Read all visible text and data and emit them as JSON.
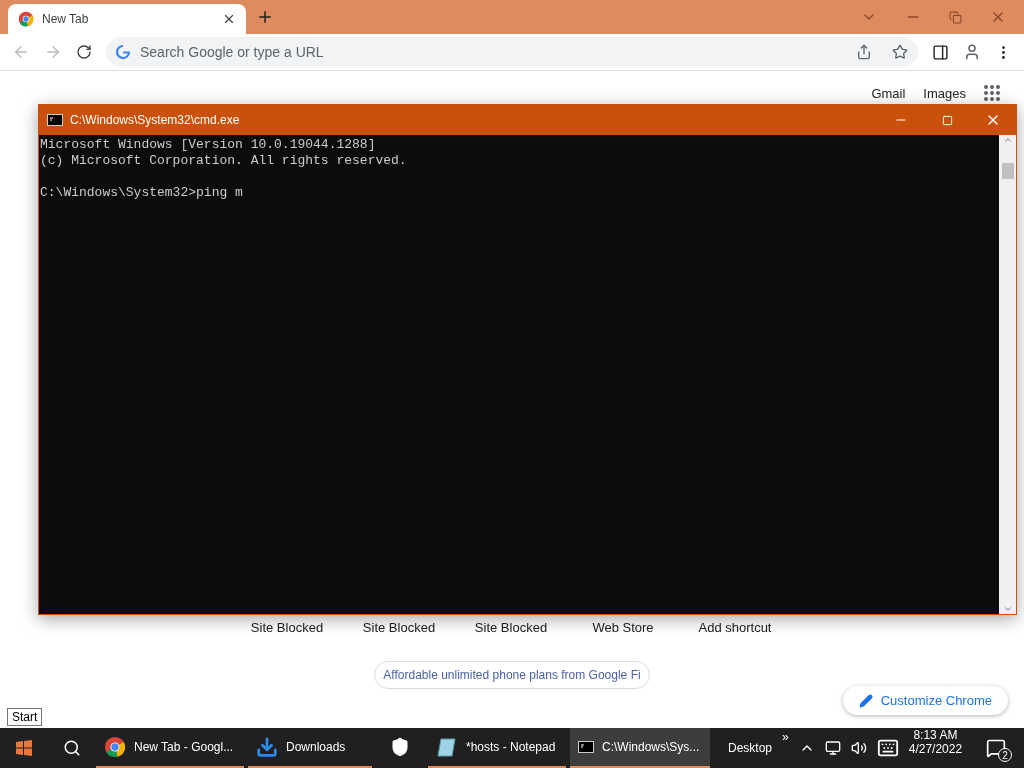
{
  "browser": {
    "tabs": [
      {
        "title": "New Tab",
        "selected": true
      }
    ],
    "omnibox": {
      "placeholder": "Search Google or type a URL"
    },
    "page": {
      "header_links": [
        "Gmail",
        "Images"
      ],
      "shortcuts": [
        "Site Blocked",
        "Site Blocked",
        "Site Blocked",
        "Web Store",
        "Add shortcut"
      ],
      "promo": "Affordable unlimited phone plans from Google Fi",
      "customize": "Customize Chrome"
    }
  },
  "console_window": {
    "title": "C:\\Windows\\System32\\cmd.exe",
    "paragraphs": [
      [
        "Microsoft Windows [Version 10.0.19044.1288]",
        "(c) Microsoft Corporation. All rights reserved."
      ],
      [
        "C:\\Windows\\System32>ping m"
      ]
    ]
  },
  "start_tooltip": "Start",
  "taskbar": {
    "items": [
      {
        "kind": "chrome",
        "label": "New Tab - Googl...",
        "running": true,
        "selected": false
      },
      {
        "kind": "download",
        "label": "Downloads",
        "running": true,
        "selected": false
      },
      {
        "kind": "shield",
        "running": false,
        "selected": false
      },
      {
        "kind": "notepad",
        "label": "*hosts - Notepad",
        "running": true,
        "selected": false
      },
      {
        "kind": "console",
        "label": "C:\\Windows\\Sys...",
        "running": true,
        "selected": true
      }
    ],
    "toolbar": "Desktop",
    "overflow": "»",
    "time": "8:13 AM",
    "date": "4/27/2022",
    "notifications": "2"
  }
}
